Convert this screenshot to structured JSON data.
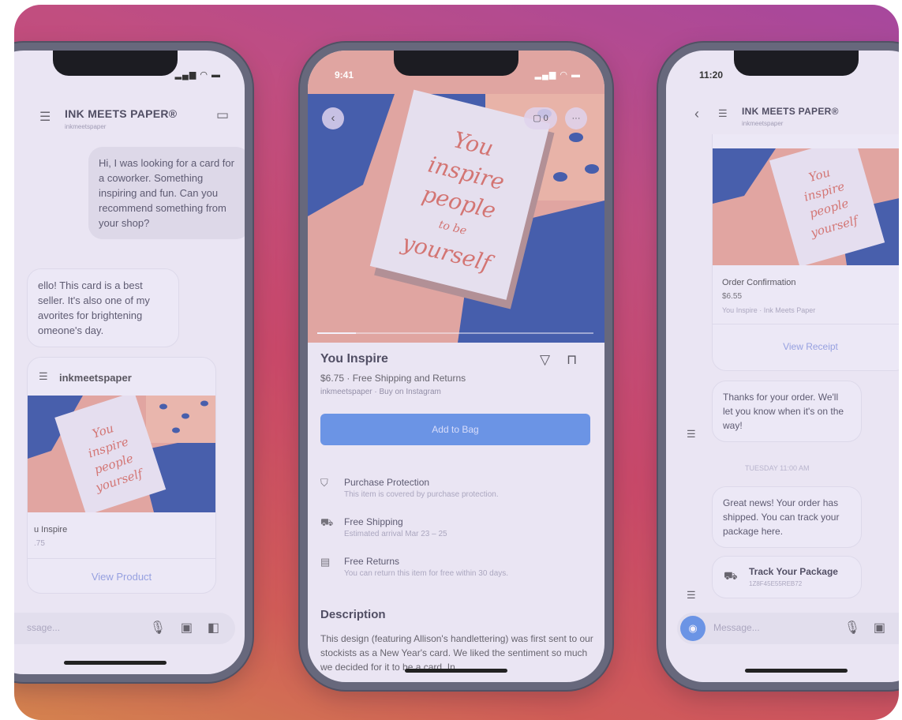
{
  "left": {
    "shop_name": "INK MEETS PAPER®",
    "shop_handle": "inkmeetspaper",
    "msg_customer": "Hi, I was looking for a card for a coworker. Something inspiring and fun. Can you recommend something from your shop?",
    "msg_shop": "ello! This card is a best seller. It's also one of my avorites for brightening omeone's day.",
    "card_handle": "inkmeetspaper",
    "product_name": "u Inspire",
    "product_price": ".75",
    "view_product": "View Product",
    "compose_placeholder": "ssage..."
  },
  "center": {
    "time": "9:41",
    "product_title": "You Inspire",
    "price_line": "$6.75 · Free Shipping and Returns",
    "seller_line": "inkmeetspaper · Buy on Instagram",
    "add_to_bag": "Add to Bag",
    "features": [
      {
        "title": "Purchase Protection",
        "desc": "This item is covered by purchase protection."
      },
      {
        "title": "Free Shipping",
        "desc": "Estimated arrival Mar 23 – 25"
      },
      {
        "title": "Free Returns",
        "desc": "You can return this item for free within 30 days."
      }
    ],
    "description_heading": "Description",
    "description_text": "This design (featuring Allison's handlettering) was first sent to our stockists as a New Year's card. We liked the sentiment so much we decided for it to be a card. In"
  },
  "right": {
    "time": "11:20",
    "shop_name": "INK MEETS PAPER®",
    "shop_handle": "inkmeetspaper",
    "order_title": "Order Confirmation",
    "order_price": "$6.55",
    "order_sub": "You Inspire · Ink Meets Paper",
    "view_receipt": "View Receipt",
    "msg_thanks": "Thanks for your order. We'll let you know when it's on the way!",
    "timestamp": "TUESDAY 11:00 AM",
    "msg_shipped": "Great news! Your order has shipped. You can track your package here.",
    "track_title": "Track Your Package",
    "track_sub": "1Z8F45E55REB72",
    "compose_placeholder": "Message..."
  },
  "card_lettering": "You inspire people to be yourself"
}
